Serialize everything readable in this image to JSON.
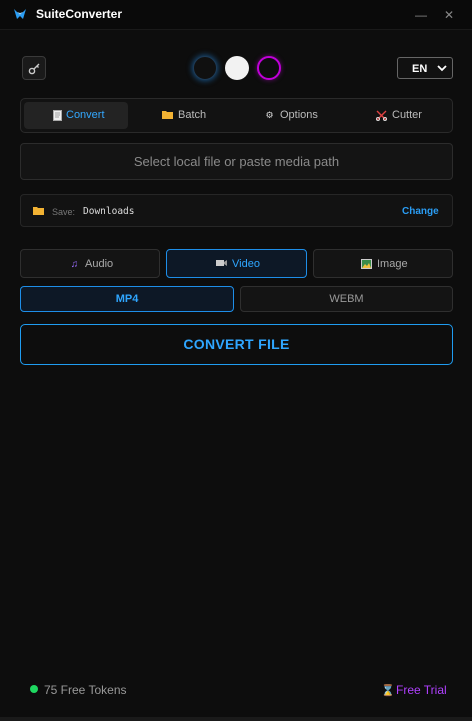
{
  "window": {
    "title": "SuiteConverter",
    "minimize_glyph": "—",
    "close_glyph": "✕"
  },
  "colors": {
    "accent": "#2fa6ff",
    "background": "#0d0d0d",
    "purple_theme": "#c000d8",
    "token_dot": "#1ed760",
    "trial": "#b040ff"
  },
  "language": {
    "selected": "EN"
  },
  "tabs": [
    {
      "label": "Convert",
      "icon": "document-icon",
      "active": true
    },
    {
      "label": "Batch",
      "icon": "folder-icon",
      "active": false
    },
    {
      "label": "Options",
      "icon": "gear-icon",
      "active": false
    },
    {
      "label": "Cutter",
      "icon": "scissors-icon",
      "active": false
    }
  ],
  "file_input": {
    "placeholder": "Select local file or paste media path"
  },
  "save": {
    "label": "Save:",
    "path": "Downloads",
    "change_label": "Change"
  },
  "modes": [
    {
      "label": "Audio",
      "icon": "music-note-icon",
      "active": false
    },
    {
      "label": "Video",
      "icon": "video-camera-icon",
      "active": true
    },
    {
      "label": "Image",
      "icon": "image-icon",
      "active": false
    }
  ],
  "formats": [
    {
      "label": "MP4",
      "active": true
    },
    {
      "label": "WEBM",
      "active": false
    }
  ],
  "convert_button": {
    "label": "CONVERT FILE"
  },
  "footer": {
    "tokens": "75 Free Tokens",
    "trial": "Free Trial"
  }
}
